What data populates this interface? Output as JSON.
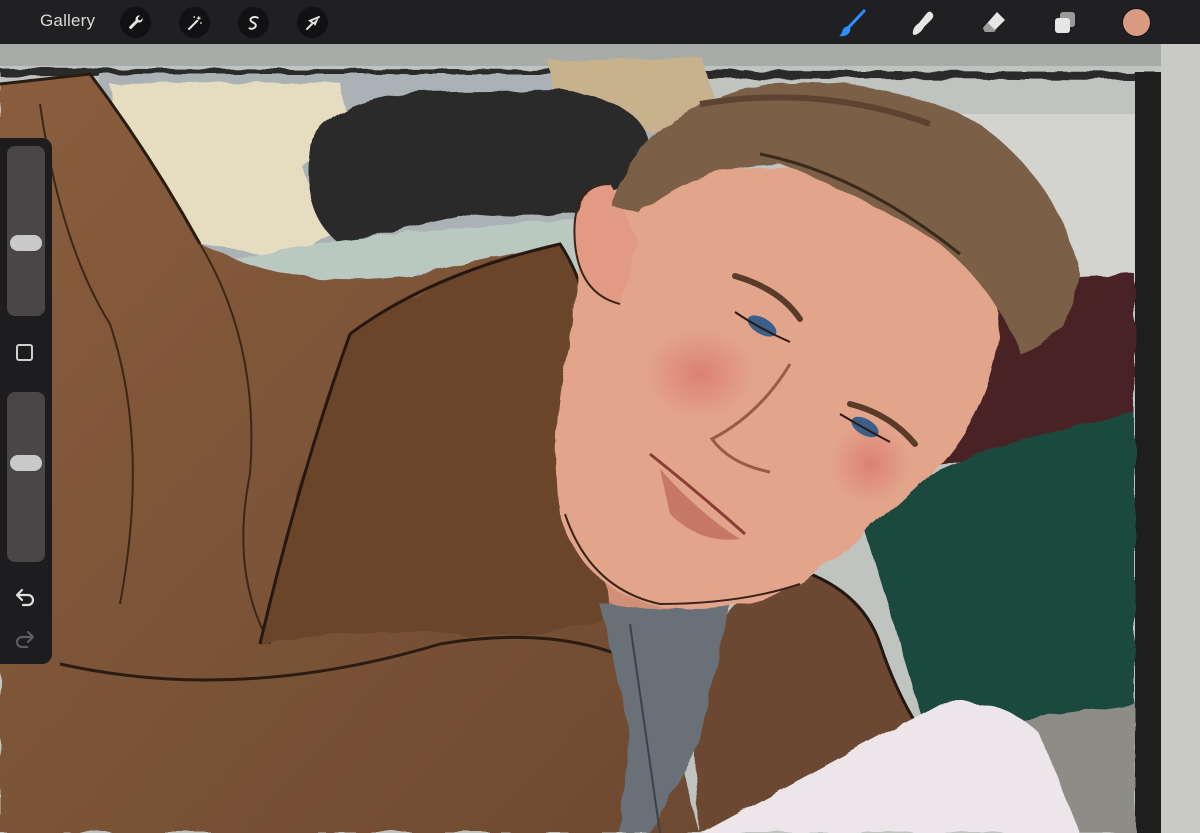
{
  "toolbar": {
    "gallery_label": "Gallery",
    "left_tools": [
      {
        "name": "actions",
        "icon": "wrench-icon"
      },
      {
        "name": "adjustments",
        "icon": "magic-wand-icon"
      },
      {
        "name": "selection",
        "icon": "selection-s-icon"
      },
      {
        "name": "transform",
        "icon": "arrow-cursor-icon"
      }
    ],
    "right_tools": [
      {
        "name": "brush",
        "icon": "brush-icon",
        "active": true
      },
      {
        "name": "smudge",
        "icon": "smudge-finger-icon",
        "active": false
      },
      {
        "name": "eraser",
        "icon": "eraser-icon",
        "active": false
      },
      {
        "name": "layers",
        "icon": "layers-icon",
        "active": false
      }
    ],
    "current_color": "#d99b82"
  },
  "sidebar": {
    "brush_size_level": 0.58,
    "opacity_level": 0.41,
    "modify_icon": "square-modify-icon",
    "undo_icon": "undo-icon",
    "redo_icon": "redo-icon",
    "redo_enabled": false
  },
  "colors": {
    "accent": "#2f8fff",
    "toolbar_bg": "#202022",
    "jacket": "#7a5236",
    "skin": "#e3a48c",
    "hair": "#7b5e47",
    "background_green": "#1d4a3c"
  }
}
